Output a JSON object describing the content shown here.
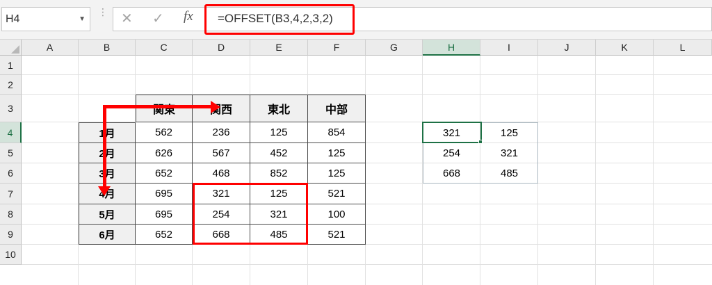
{
  "formula_bar": {
    "name_box": "H4",
    "dots": "⋮",
    "cancel_icon": "✕",
    "enter_icon": "✓",
    "fx_label": "fx",
    "formula": "=OFFSET(B3,4,2,3,2)"
  },
  "columns": [
    "A",
    "B",
    "C",
    "D",
    "E",
    "F",
    "G",
    "H",
    "I",
    "J",
    "K",
    "L"
  ],
  "rows": [
    "1",
    "2",
    "3",
    "4",
    "5",
    "6",
    "7",
    "8",
    "9",
    "10"
  ],
  "active_column": "H",
  "active_row": "4",
  "table": {
    "headers": [
      "",
      "関東",
      "関西",
      "東北",
      "中部"
    ],
    "rows": [
      {
        "label": "1月",
        "values": [
          "562",
          "236",
          "125",
          "854"
        ]
      },
      {
        "label": "2月",
        "values": [
          "626",
          "567",
          "452",
          "125"
        ]
      },
      {
        "label": "3月",
        "values": [
          "652",
          "468",
          "852",
          "125"
        ]
      },
      {
        "label": "4月",
        "values": [
          "695",
          "321",
          "125",
          "521"
        ]
      },
      {
        "label": "5月",
        "values": [
          "695",
          "254",
          "321",
          "100"
        ]
      },
      {
        "label": "6月",
        "values": [
          "652",
          "668",
          "485",
          "521"
        ]
      }
    ]
  },
  "result": {
    "rows": [
      [
        "321",
        "125"
      ],
      [
        "254",
        "321"
      ],
      [
        "668",
        "485"
      ]
    ]
  },
  "colors": {
    "highlight": "#ff0000",
    "active_cell": "#1e7145"
  }
}
